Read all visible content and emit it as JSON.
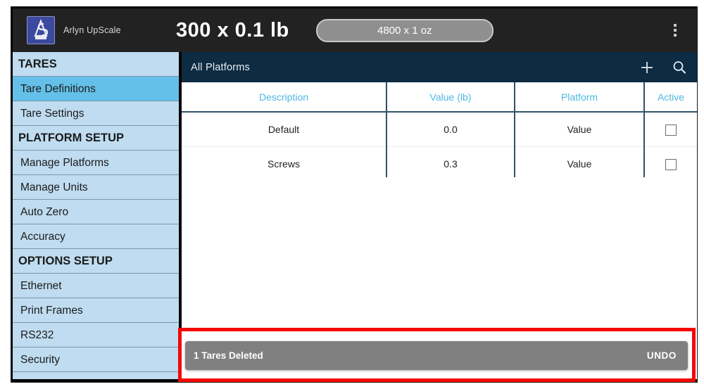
{
  "header": {
    "brand_name": "Arlyn UpScale",
    "logo_icon": "arlyn-scale-logo",
    "capacity": "300 x 0.1 lb",
    "unit_toggle": "4800 x 1 oz",
    "overflow_icon": "more-vertical-icon"
  },
  "sidebar": {
    "items": [
      {
        "label": "TARES",
        "type": "header",
        "selected": false
      },
      {
        "label": "Tare Definitions",
        "type": "item",
        "selected": true
      },
      {
        "label": "Tare Settings",
        "type": "item",
        "selected": false
      },
      {
        "label": "PLATFORM SETUP",
        "type": "header",
        "selected": false
      },
      {
        "label": "Manage Platforms",
        "type": "item",
        "selected": false
      },
      {
        "label": "Manage Units",
        "type": "item",
        "selected": false
      },
      {
        "label": "Auto Zero",
        "type": "item",
        "selected": false
      },
      {
        "label": "Accuracy",
        "type": "item",
        "selected": false
      },
      {
        "label": "OPTIONS SETUP",
        "type": "header",
        "selected": false
      },
      {
        "label": "Ethernet",
        "type": "item",
        "selected": false
      },
      {
        "label": "Print Frames",
        "type": "item",
        "selected": false
      },
      {
        "label": "RS232",
        "type": "item",
        "selected": false
      },
      {
        "label": "Security",
        "type": "item",
        "selected": false
      }
    ]
  },
  "content": {
    "title": "All Platforms",
    "add_icon": "plus-icon",
    "search_icon": "search-icon",
    "table": {
      "columns": [
        "Description",
        "Value (lb)",
        "Platform",
        "Active"
      ],
      "rows": [
        {
          "description": "Default",
          "value": "0.0",
          "platform": "Value",
          "active": false
        },
        {
          "description": "Screws",
          "value": "0.3",
          "platform": "Value",
          "active": false
        }
      ]
    }
  },
  "snackbar": {
    "message": "1 Tares Deleted",
    "action": "UNDO"
  },
  "colors": {
    "topbar": "#222222",
    "sidebar": "#bfdcf0",
    "sidebar_selected": "#64c0e8",
    "content_header": "#0d2b42",
    "column_header_text": "#4eb8e4",
    "highlight": "#f60505",
    "snackbar": "#808080"
  }
}
